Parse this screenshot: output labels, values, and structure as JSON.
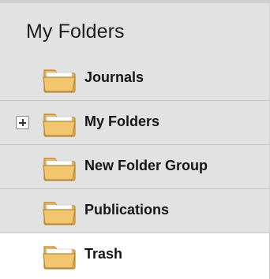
{
  "panel": {
    "title": "My Folders"
  },
  "folders": [
    {
      "label": "Journals",
      "expandable": false,
      "selected": false
    },
    {
      "label": "My Folders",
      "expandable": true,
      "selected": false
    },
    {
      "label": "New Folder Group",
      "expandable": false,
      "selected": false
    },
    {
      "label": "Publications",
      "expandable": false,
      "selected": false
    },
    {
      "label": "Trash",
      "expandable": false,
      "selected": true
    }
  ],
  "icons": {
    "folder": "folder-icon",
    "expand": "expand-plus-icon"
  },
  "colors": {
    "panel_bg": "#e2e2e2",
    "selected_bg": "#ffffff",
    "folder_fill": "#f2c66e",
    "folder_edge": "#b8893a"
  }
}
